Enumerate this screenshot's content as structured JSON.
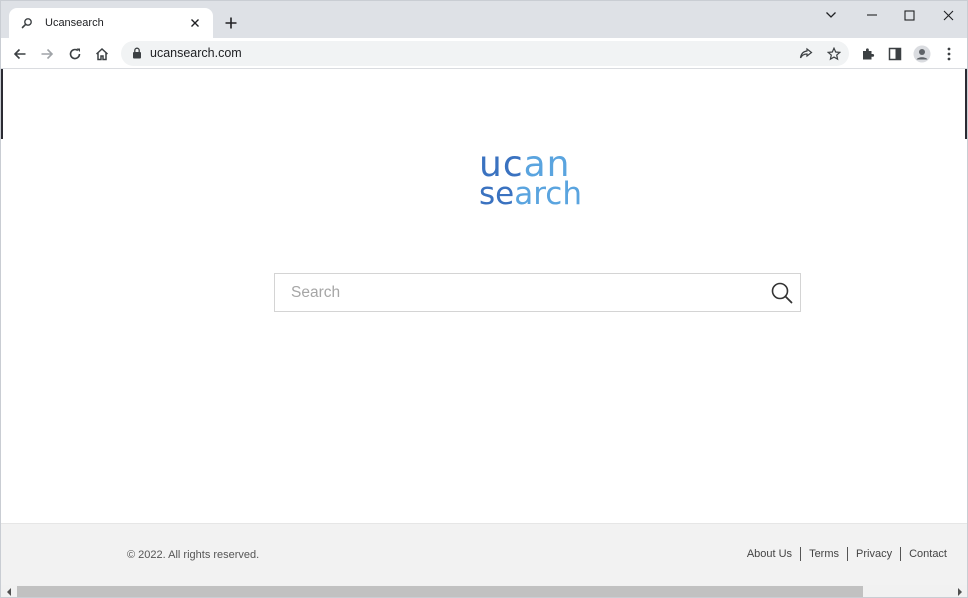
{
  "browser": {
    "tab_title": "Ucansearch",
    "address": "ucansearch.com"
  },
  "logo": {
    "line1_a": "uc",
    "line1_b": "an",
    "line2_a": "se",
    "line2_b": "arch"
  },
  "search": {
    "placeholder": "Search"
  },
  "footer": {
    "copyright": "© 2022. All rights reserved.",
    "links": [
      "About Us",
      "Terms",
      "Privacy",
      "Contact"
    ]
  },
  "colors": {
    "logo_dark": "#3a72c0",
    "logo_light": "#5aa4df",
    "tab_strip": "#dee1e6",
    "footer_bg": "#f2f2f2"
  },
  "icons": {
    "tab_favicon": "search-icon",
    "tab_close": "close-icon",
    "new_tab": "plus-icon",
    "back": "arrow-left-icon",
    "forward": "arrow-right-icon",
    "reload": "reload-icon",
    "home": "home-icon",
    "lock": "lock-icon",
    "share": "share-icon",
    "bookmark": "star-icon",
    "extensions": "puzzle-icon",
    "side_panel": "side-panel-icon",
    "profile": "profile-icon",
    "menu": "kebab-menu-icon",
    "search_button": "magnifier-icon"
  }
}
